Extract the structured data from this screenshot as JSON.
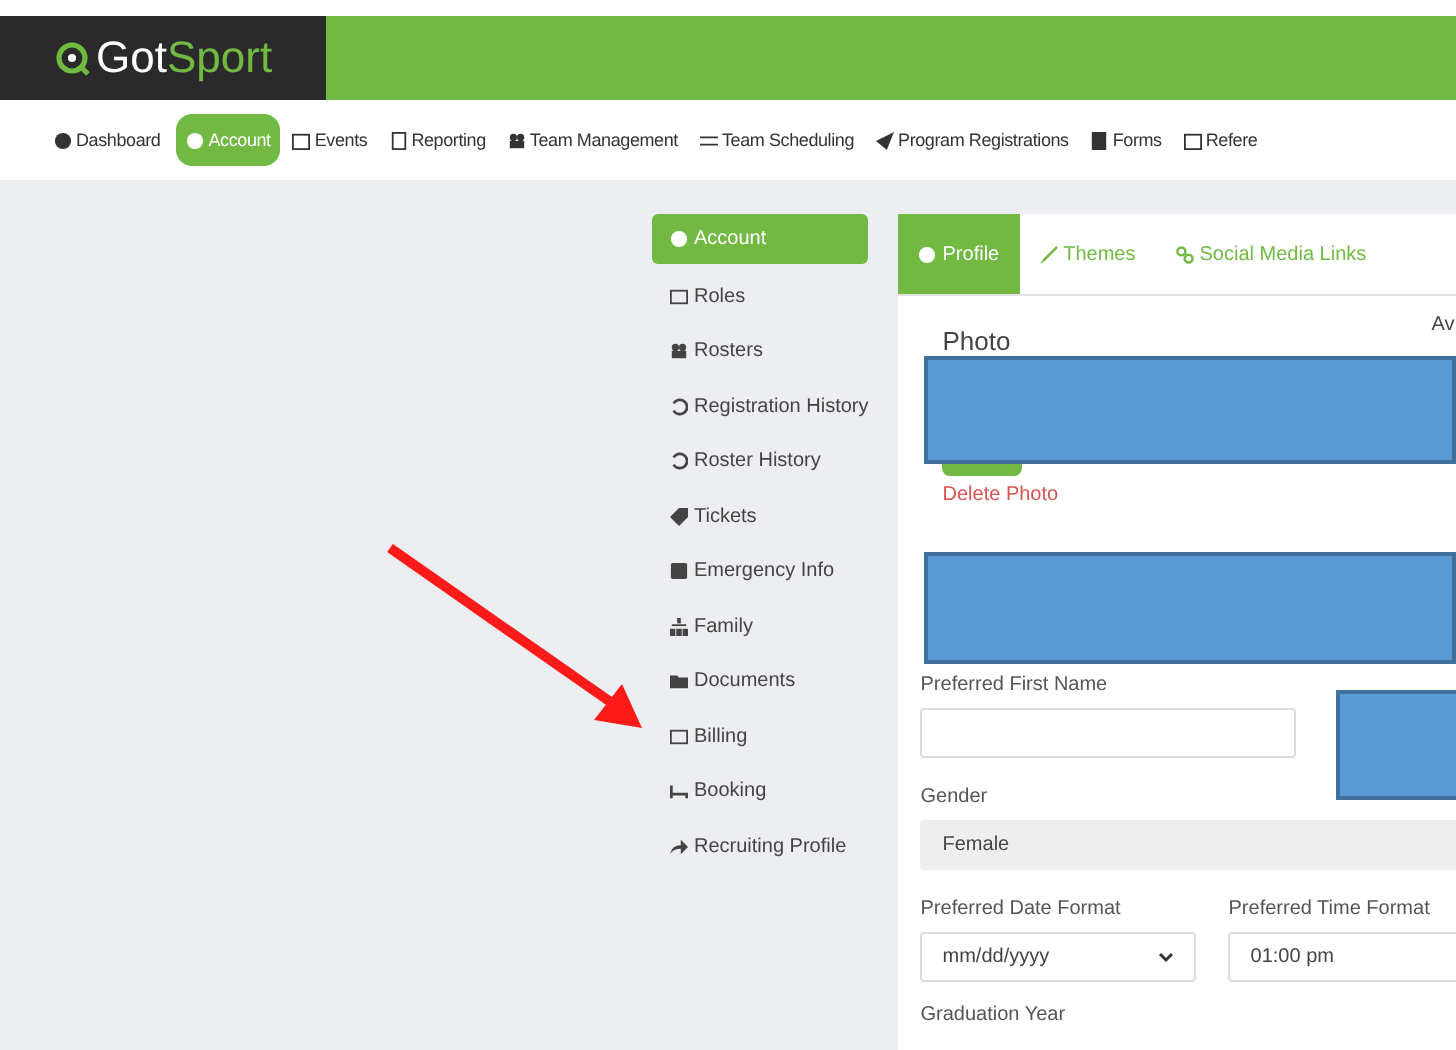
{
  "header": {
    "logo_left": "Got",
    "logo_right": "Sport"
  },
  "nav": [
    {
      "label": "Dashboard",
      "selected": false
    },
    {
      "label": "Account",
      "selected": true
    },
    {
      "label": "Events",
      "selected": false
    },
    {
      "label": "Reporting",
      "selected": false
    },
    {
      "label": "Team Management",
      "selected": false
    },
    {
      "label": "Team Scheduling",
      "selected": false
    },
    {
      "label": "Program Registrations",
      "selected": false
    },
    {
      "label": "Forms",
      "selected": false
    },
    {
      "label": "Refere",
      "selected": false
    }
  ],
  "sidebar": {
    "items": [
      {
        "label": "Account",
        "selected": true
      },
      {
        "label": "Roles",
        "selected": false
      },
      {
        "label": "Rosters",
        "selected": false
      },
      {
        "label": "Registration History",
        "selected": false
      },
      {
        "label": "Roster History",
        "selected": false
      },
      {
        "label": "Tickets",
        "selected": false
      },
      {
        "label": "Emergency Info",
        "selected": false
      },
      {
        "label": "Family",
        "selected": false
      },
      {
        "label": "Documents",
        "selected": false
      },
      {
        "label": "Billing",
        "selected": false
      },
      {
        "label": "Booking",
        "selected": false
      },
      {
        "label": "Recruiting Profile",
        "selected": false
      }
    ]
  },
  "tabs": [
    {
      "label": "Profile",
      "selected": true
    },
    {
      "label": "Themes",
      "selected": false
    },
    {
      "label": "Social Media Links",
      "selected": false
    }
  ],
  "profile": {
    "photo_heading": "Photo",
    "side_heading": "Av",
    "delete_photo": "Delete Photo",
    "preferred_first_name": {
      "label": "Preferred First Name"
    },
    "gender": {
      "label": "Gender",
      "value": "Female"
    },
    "date_format": {
      "label": "Preferred Date Format",
      "value": "mm/dd/yyyy"
    },
    "time_format": {
      "label": "Preferred Time Format",
      "value": "01:00 pm"
    },
    "graduation_year": {
      "label": "Graduation Year"
    }
  },
  "annotations": [
    {
      "kind": "redaction"
    },
    {
      "kind": "redaction"
    },
    {
      "kind": "redaction"
    },
    {
      "kind": "arrow",
      "color": "#ff1a1a"
    }
  ]
}
